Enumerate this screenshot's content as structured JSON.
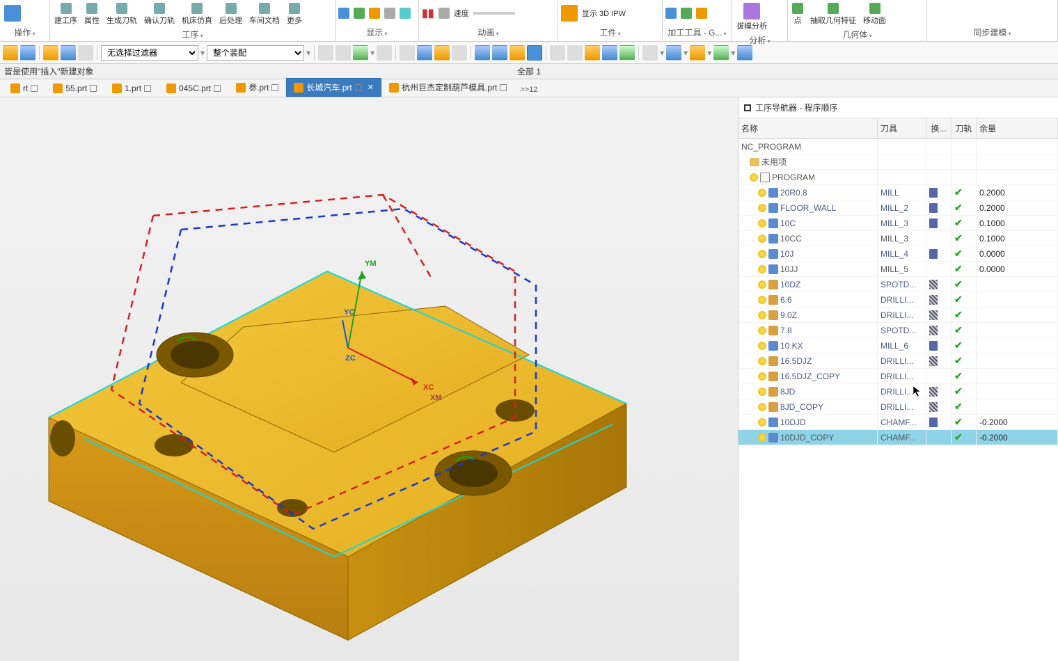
{
  "ribbon": {
    "groups": [
      {
        "items": [
          "建工序",
          "属性",
          "生成刀轨",
          "确认刀轨",
          "机床仿真",
          "后处理",
          "车间文档",
          "更多"
        ],
        "label": "工序"
      },
      {
        "items": [],
        "label": "操作"
      },
      {
        "items": [],
        "icons": true,
        "label": "显示"
      },
      {
        "items": [
          "速度"
        ],
        "pause": true,
        "label": "动画"
      },
      {
        "items": [
          "显示 3D IPW"
        ],
        "label": "工件"
      },
      {
        "items": [],
        "label": "加工工具 - G..."
      },
      {
        "items": [
          "拔模分析"
        ],
        "label": "分析"
      },
      {
        "items": [
          "点",
          "抽取几何特征",
          "移动面"
        ],
        "label": "几何体"
      },
      {
        "items": [],
        "label": "同步建模"
      }
    ]
  },
  "toolbar": {
    "filter1": "无选择过滤器",
    "filter2": "整个装配"
  },
  "status": {
    "left": "皆是使用\"插入\"新建对象",
    "mid": "全部 1"
  },
  "tabs": [
    {
      "label": "rt",
      "ext": true
    },
    {
      "label": "55.prt",
      "ext": true
    },
    {
      "label": "1.prt",
      "ext": true
    },
    {
      "label": "045C.prt",
      "ext": true
    },
    {
      "label": "参.prt",
      "ext": true
    },
    {
      "label": "长城汽车.prt",
      "ext": true,
      "active": true
    },
    {
      "label": "杭州巨杰定制葫芦模具.prt",
      "ext": true
    }
  ],
  "tab_more": ">>12",
  "side": {
    "title": "工序导航器 - 程序顺序",
    "cols": {
      "name": "名称",
      "tool": "刀具",
      "change": "换...",
      "path": "刀轨",
      "remain": "余量"
    },
    "rows": [
      {
        "indent": 0,
        "type": "root",
        "name": "NC_PROGRAM"
      },
      {
        "indent": 1,
        "type": "folder",
        "name": "未用项"
      },
      {
        "indent": 1,
        "type": "prog",
        "name": "PROGRAM",
        "bulb": true
      },
      {
        "indent": 2,
        "type": "mill",
        "name": "20R0.8",
        "tool": "MILL",
        "ch": "t",
        "tp": true,
        "rem": "0.2000",
        "link": true
      },
      {
        "indent": 2,
        "type": "mill",
        "name": "FLOOR_WALL",
        "tool": "MILL_2",
        "ch": "t",
        "tp": true,
        "rem": "0.2000",
        "link": true
      },
      {
        "indent": 2,
        "type": "mill",
        "name": "10C",
        "tool": "MILL_3",
        "ch": "t",
        "tp": true,
        "rem": "0.1000",
        "link": true
      },
      {
        "indent": 2,
        "type": "mill",
        "name": "10CC",
        "tool": "MILL_3",
        "ch": "",
        "tp": true,
        "rem": "0.1000",
        "link": false
      },
      {
        "indent": 2,
        "type": "mill",
        "name": "10J",
        "tool": "MILL_4",
        "ch": "t",
        "tp": true,
        "rem": "0.0000",
        "link": true
      },
      {
        "indent": 2,
        "type": "mill",
        "name": "10JJ",
        "tool": "MILL_5",
        "ch": "",
        "tp": true,
        "rem": "0.0000",
        "link": false
      },
      {
        "indent": 2,
        "type": "drill",
        "name": "10DZ",
        "tool": "SPOTD...",
        "ch": "h",
        "tp": true,
        "link": true
      },
      {
        "indent": 2,
        "type": "drill",
        "name": "6.6",
        "tool": "DRILLI...",
        "ch": "h",
        "tp": true,
        "link": true
      },
      {
        "indent": 2,
        "type": "drill",
        "name": "9.0Z",
        "tool": "DRILLI...",
        "ch": "h",
        "tp": true,
        "link": true
      },
      {
        "indent": 2,
        "type": "drill",
        "name": "7.8",
        "tool": "SPOTD...",
        "ch": "h",
        "tp": true,
        "link": true
      },
      {
        "indent": 2,
        "type": "mill",
        "name": "10.KX",
        "tool": "MILL_6",
        "ch": "t",
        "tp": true,
        "link": true,
        "icon": "mill2"
      },
      {
        "indent": 2,
        "type": "drill",
        "name": "16.5DJZ",
        "tool": "DRILLI...",
        "ch": "h",
        "tp": true,
        "link": true
      },
      {
        "indent": 2,
        "type": "drill",
        "name": "16.5DJZ_COPY",
        "tool": "DRILLI...",
        "ch": "",
        "tp": true,
        "link": true,
        "hl": true
      },
      {
        "indent": 2,
        "type": "drill",
        "name": "8JD",
        "tool": "DRILLI...",
        "ch": "h",
        "tp": true,
        "link": true,
        "hl": true,
        "cursor": true
      },
      {
        "indent": 2,
        "type": "drill",
        "name": "8JD_COPY",
        "tool": "DRILLI...",
        "ch": "h",
        "tp": true,
        "link": true,
        "hl": true
      },
      {
        "indent": 2,
        "type": "mill",
        "name": "10DJD",
        "tool": "CHAMF...",
        "ch": "t",
        "tp": true,
        "rem": "-0.2000",
        "link": true
      },
      {
        "indent": 2,
        "type": "mill",
        "name": "10DJD_COPY",
        "tool": "CHAMF...",
        "ch": "",
        "tp": true,
        "rem": "-0.2000",
        "link": false,
        "sel": true
      }
    ]
  },
  "axes": {
    "x": "XC",
    "y": "YC",
    "z": "ZC",
    "xm": "XM",
    "ym": "YM"
  }
}
